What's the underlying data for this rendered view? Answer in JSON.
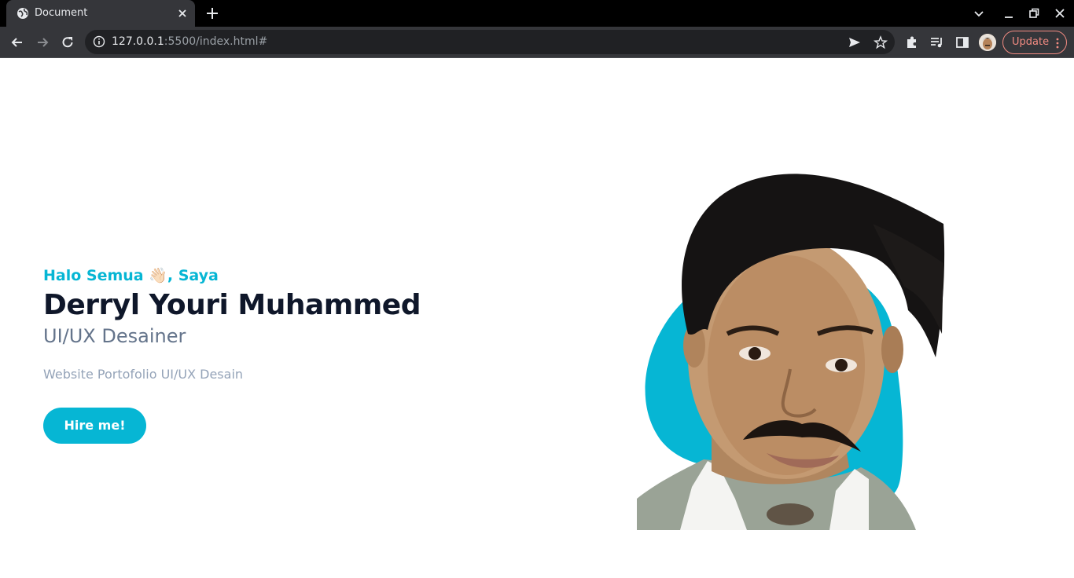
{
  "browser": {
    "tab_title": "Document",
    "url_host": "127.0.0.1",
    "url_rest": ":5500/index.html#",
    "update_label": "Update",
    "accent_update": "#f28b82"
  },
  "hero": {
    "greeting": "Halo Semua 👋🏻, Saya",
    "name": "Derryl Youri Muhammed",
    "role": "UI/UX Desainer",
    "description": "Website Portofolio UI/UX Desain",
    "cta_label": "Hire me!",
    "accent_color": "#06b6d4"
  }
}
